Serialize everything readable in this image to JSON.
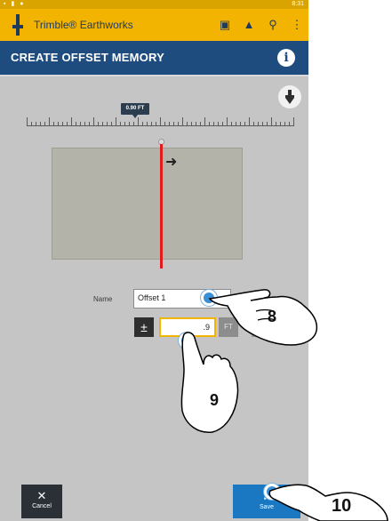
{
  "status_bar": {
    "time": "8:31"
  },
  "app": {
    "title": "Trimble® Earthworks"
  },
  "header": {
    "title": "CREATE OFFSET MEMORY",
    "info_icon": "info-icon"
  },
  "ruler": {
    "selected_label": "0.90 FT"
  },
  "form": {
    "name_label": "Name",
    "name_value": "Offset 1",
    "plus_minus_label": "±",
    "offset_value": ".9",
    "unit_label": "FT"
  },
  "footer": {
    "cancel_label": "Cancel",
    "save_label": "Save"
  },
  "annotations": {
    "step_8": "8",
    "step_9": "9",
    "step_10": "10"
  },
  "colors": {
    "app_bar": "#f2b400",
    "title_bar": "#1e4c7e",
    "save_button": "#1a78c2",
    "offset_line": "#e11b1b",
    "touch_point": "#3b8fd4"
  }
}
